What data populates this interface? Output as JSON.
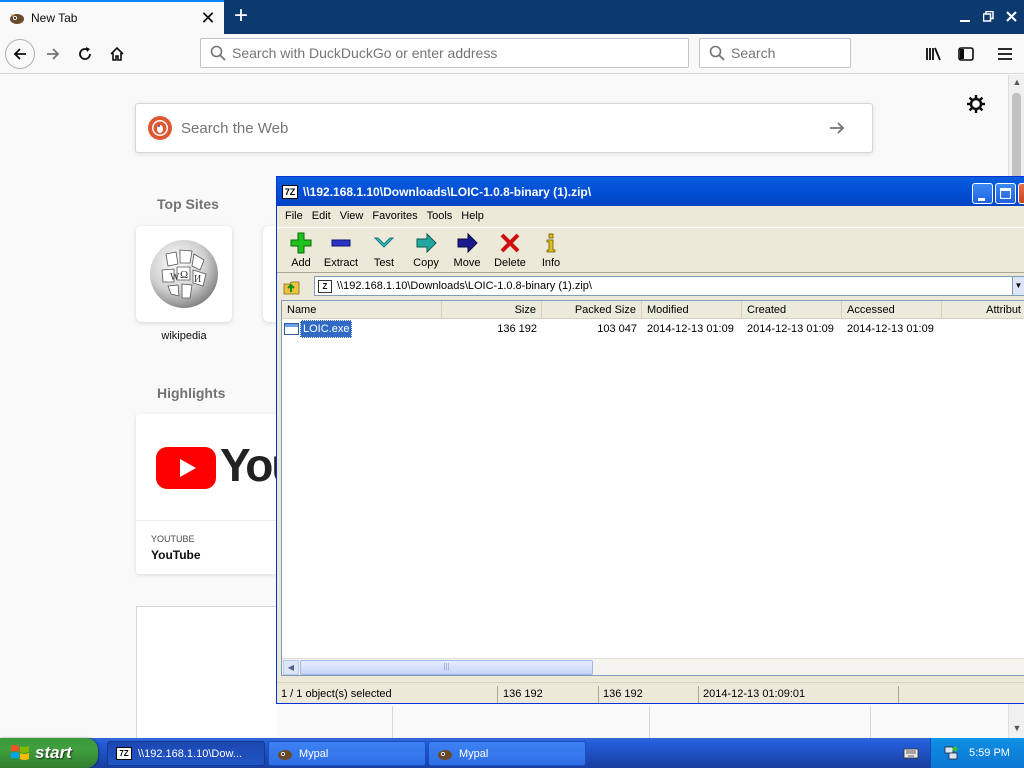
{
  "browser": {
    "tab_title": "New Tab",
    "tab_close": "✕",
    "new_tab": "+",
    "url_placeholder": "Search with DuckDuckGo or enter address",
    "search_placeholder": "Search"
  },
  "newtab": {
    "search_placeholder": "Search the Web",
    "top_sites_heading": "Top Sites",
    "top_sites": [
      {
        "label": "wikipedia"
      }
    ],
    "highlights_heading": "Highlights",
    "highlights": [
      {
        "host": "YOUTUBE",
        "title": "YouTube",
        "brand_text": "You"
      }
    ]
  },
  "sevenzip": {
    "title": "\\\\192.168.1.10\\Downloads\\LOIC-1.0.8-binary (1).zip\\",
    "app_badge": "7Z",
    "menu": [
      "File",
      "Edit",
      "View",
      "Favorites",
      "Tools",
      "Help"
    ],
    "toolbar": [
      {
        "label": "Add",
        "icon": "add-icon"
      },
      {
        "label": "Extract",
        "icon": "extract-icon"
      },
      {
        "label": "Test",
        "icon": "test-icon"
      },
      {
        "label": "Copy",
        "icon": "copy-icon"
      },
      {
        "label": "Move",
        "icon": "move-icon"
      },
      {
        "label": "Delete",
        "icon": "delete-icon"
      },
      {
        "label": "Info",
        "icon": "info-icon"
      }
    ],
    "address": "\\\\192.168.1.10\\Downloads\\LOIC-1.0.8-binary (1).zip\\",
    "columns": [
      "Name",
      "Size",
      "Packed Size",
      "Modified",
      "Created",
      "Accessed",
      "Attribut"
    ],
    "rows": [
      {
        "name": "LOIC.exe",
        "size": "136 192",
        "packed": "103 047",
        "modified": "2014-12-13 01:09",
        "created": "2014-12-13 01:09",
        "accessed": "2014-12-13 01:09"
      }
    ],
    "status": {
      "selection": "1 / 1 object(s) selected",
      "size": "136 192",
      "packed": "136 192",
      "modified": "2014-12-13 01:09:01"
    }
  },
  "taskbar": {
    "start_label": "start",
    "buttons": [
      {
        "label": "\\\\192.168.1.10\\Dow...",
        "icon": "7zip-icon",
        "active": true
      },
      {
        "label": "Mypal",
        "icon": "mypal-icon",
        "active": false
      },
      {
        "label": "Mypal",
        "icon": "mypal-icon",
        "active": false
      }
    ],
    "clock": "5:59 PM"
  },
  "colors": {
    "firefox_tabbar": "#0c3a6e",
    "xp_title_blue": "#0250d6",
    "selection_blue": "#316ac5",
    "ddg_orange": "#de5833",
    "youtube_red": "#ff0000"
  }
}
